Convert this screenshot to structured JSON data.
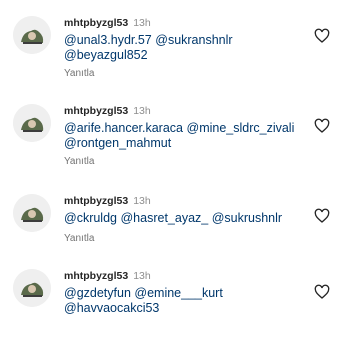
{
  "comments": [
    {
      "username": "mhtpbyzgl53",
      "time": "13h",
      "mentions": [
        "@unal3.hydr.57",
        "@sukranshnlr",
        "@beyazgul852"
      ],
      "reply_label": "Yanıtla",
      "like_icon": "heart-outline-icon"
    },
    {
      "username": "mhtpbyzgl53",
      "time": "13h",
      "mentions": [
        "@arife.hancer.karaca",
        "@mine_sldrc_zivali",
        "@rontgen_mahmut"
      ],
      "reply_label": "Yanıtla",
      "like_icon": "heart-outline-icon"
    },
    {
      "username": "mhtpbyzgl53",
      "time": "13h",
      "mentions": [
        "@ckruldg",
        "@hasret_ayaz_",
        "@sukrushnlr"
      ],
      "reply_label": "Yanıtla",
      "like_icon": "heart-outline-icon"
    },
    {
      "username": "mhtpbyzgl53",
      "time": "13h",
      "mentions": [
        "@gzdetyfun",
        "@emine___kurt",
        "@havvaocakci53"
      ],
      "reply_label": "Yanıtla",
      "like_icon": "heart-outline-icon"
    }
  ],
  "colors": {
    "mention": "#00376b",
    "username": "#262626",
    "muted": "#8e8e8e"
  }
}
